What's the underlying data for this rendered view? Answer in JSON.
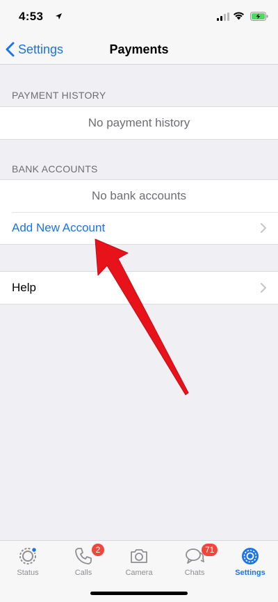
{
  "status_bar": {
    "time": "4:53",
    "icons": [
      "location-arrow-icon",
      "cellular-signal-icon",
      "wifi-icon",
      "battery-charging-icon"
    ],
    "battery_color": "#4cd964"
  },
  "nav": {
    "back_label": "Settings",
    "title": "Payments"
  },
  "payment_history": {
    "header": "PAYMENT HISTORY",
    "empty_text": "No payment history"
  },
  "bank_accounts": {
    "header": "BANK ACCOUNTS",
    "empty_text": "No bank accounts",
    "add_label": "Add New Account"
  },
  "help": {
    "label": "Help"
  },
  "annotation": {
    "type": "red-arrow",
    "color": "#e8121a",
    "points_to": "Add New Account"
  },
  "tab_bar": {
    "tabs": [
      {
        "label": "Status",
        "icon": "status-icon",
        "active": false
      },
      {
        "label": "Calls",
        "icon": "phone-icon",
        "badge": "2",
        "active": false
      },
      {
        "label": "Camera",
        "icon": "camera-icon",
        "active": false
      },
      {
        "label": "Chats",
        "icon": "chat-bubbles-icon",
        "badge": "71",
        "active": false
      },
      {
        "label": "Settings",
        "icon": "gear-icon",
        "active": true
      }
    ],
    "accent_color": "#1a73e8",
    "inactive_color": "#8e8e93",
    "badge_color": "#f0463c"
  }
}
